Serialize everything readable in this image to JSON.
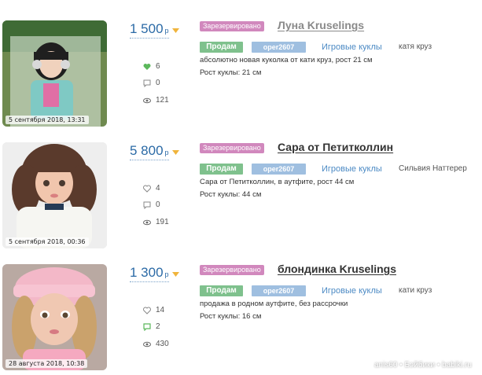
{
  "listings": [
    {
      "date": "5 сентября 2018, 13:31",
      "price": "1 500",
      "currency": "р",
      "reserved_label": "Зарезервировано",
      "title": "Луна Kruselings",
      "sell_label": "Продам",
      "user": "oper2607",
      "category": "Игровые куклы",
      "author": "катя круз",
      "likes": "6",
      "comments": "0",
      "views": "121",
      "description": "абсолютно новая куколка от кати круз, рост 21 см",
      "height": "Рост куклы: 21 см"
    },
    {
      "date": "5 сентября 2018, 00:36",
      "price": "5 800",
      "currency": "р",
      "reserved_label": "Зарезервировано",
      "title": "Сара от Петитколлин",
      "sell_label": "Продам",
      "user": "oper2607",
      "category": "Игровые куклы",
      "author": "Сильвия Наттерер",
      "likes": "4",
      "comments": "0",
      "views": "191",
      "description": "Сара от Петитколлин, в аутфите, рост 44 см",
      "height": "Рост куклы: 44 см"
    },
    {
      "date": "28 августа 2018, 10:38",
      "price": "1 300",
      "currency": "р",
      "reserved_label": "Зарезервировано",
      "title": "блондинка Kruselings",
      "sell_label": "Продам",
      "user": "oper2607",
      "category": "Игровые куклы",
      "author": "кати круз",
      "likes": "14",
      "comments": "2",
      "views": "430",
      "description": "продажа в родном аутфите, без рассрочки",
      "height": "Рост куклы: 16 см"
    }
  ],
  "watermark": "anis60 • Бэйбики • babiki.ru",
  "colors": {
    "reserved": "#d188bd",
    "sell": "#7fc18d",
    "user": "#9fbfe0",
    "price": "#2b6aa6",
    "link": "#4c8ac4",
    "like_active": "#5cb85c",
    "comment_active": "#5cb85c"
  },
  "icons": [
    "heart-icon",
    "comment-icon",
    "eye-icon",
    "price-drop-arrow-icon"
  ]
}
